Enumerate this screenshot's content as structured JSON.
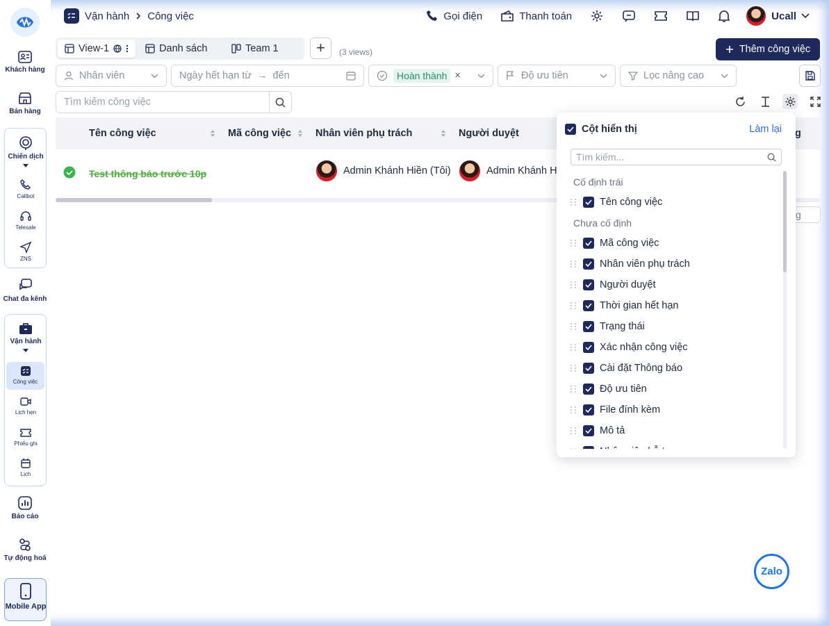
{
  "sidebar": {
    "items": {
      "customers": "Khách hàng",
      "sales": "Bán hàng",
      "campaigns": "Chiến dịch",
      "callbot": "Callbot",
      "telesale": "Telesale",
      "zns": "ZNS",
      "omnichat": "Chat đa kênh",
      "operations": "Vận hành",
      "tasks": "Công việc",
      "appointments": "Lịch hẹn",
      "tickets": "Phiếu ghi",
      "calendar": "Lịch",
      "reports": "Báo cáo",
      "automation": "Tự động hoá",
      "mobile": "Mobile App"
    }
  },
  "header": {
    "breadcrumb_parent": "Vận hành",
    "breadcrumb_current": "Công việc",
    "call_label": "Gọi điện",
    "payment_label": "Thanh toán",
    "user_name": "Ucall"
  },
  "views": {
    "tabs": [
      "View-1",
      "Danh sách",
      "Team 1"
    ],
    "count_label": "(3 views)",
    "add_task_label": "Thêm công việc"
  },
  "filters": {
    "staff": "Nhân viên",
    "due_from": "Ngày hết hạn từ",
    "due_arrow": "→",
    "due_to": "đến",
    "status_chip": "Hoàn thành",
    "chip_close": "×",
    "priority": "Độ ưu tiên",
    "advanced": "Lọc nâng cao",
    "search_placeholder": "Tìm kiếm công việc"
  },
  "table": {
    "columns": [
      "Tên công việc",
      "Mã công việc",
      "Nhân viên phụ trách",
      "Người duyệt"
    ],
    "edge_header_fragment": "g",
    "rows": [
      {
        "name": "Test thông báo trước 10p",
        "code": "",
        "assignee": "Admin Khánh Hiền (Tôi)",
        "approver": "Admin Khánh Hi"
      }
    ],
    "pager_fragment": "g"
  },
  "column_panel": {
    "title": "Cột hiển thị",
    "reset_label": "Làm lại",
    "search_placeholder": "Tìm kiếm...",
    "fixed_section": "Cố định trái",
    "fixed_columns": [
      "Tên công việc"
    ],
    "unfixed_section": "Chưa cố định",
    "unfixed_columns": [
      "Mã công việc",
      "Nhân viên phụ trách",
      "Người duyệt",
      "Thời gian hết hạn",
      "Trạng thái",
      "Xác nhận công việc",
      "Cài đặt Thông báo",
      "Độ ưu tiên",
      "File đính kèm",
      "Mô tả",
      "Nhân viên hỗ trợ"
    ]
  },
  "zalo_label": "Zalo",
  "colors": {
    "brand": "#1f2a5a",
    "done": "#4caf3b",
    "link": "#2f6fd8",
    "chip_bg": "#e3f4ee"
  }
}
